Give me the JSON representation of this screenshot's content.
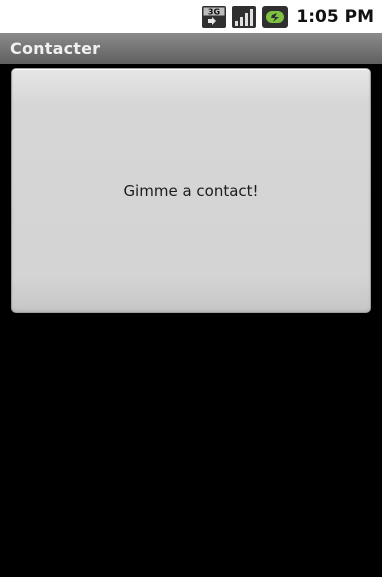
{
  "status_bar": {
    "network_badge": "3G",
    "clock": "1:05 PM",
    "icons": [
      "3g-network-icon",
      "signal-strength-icon",
      "battery-charging-icon"
    ]
  },
  "app": {
    "title": "Contacter"
  },
  "main": {
    "button_label": "Gimme a contact!"
  },
  "colors": {
    "status_bar_bg": "#ffffff",
    "title_bar_bg": "#707070",
    "background": "#000000",
    "button_bg": "#d4d4d4"
  }
}
